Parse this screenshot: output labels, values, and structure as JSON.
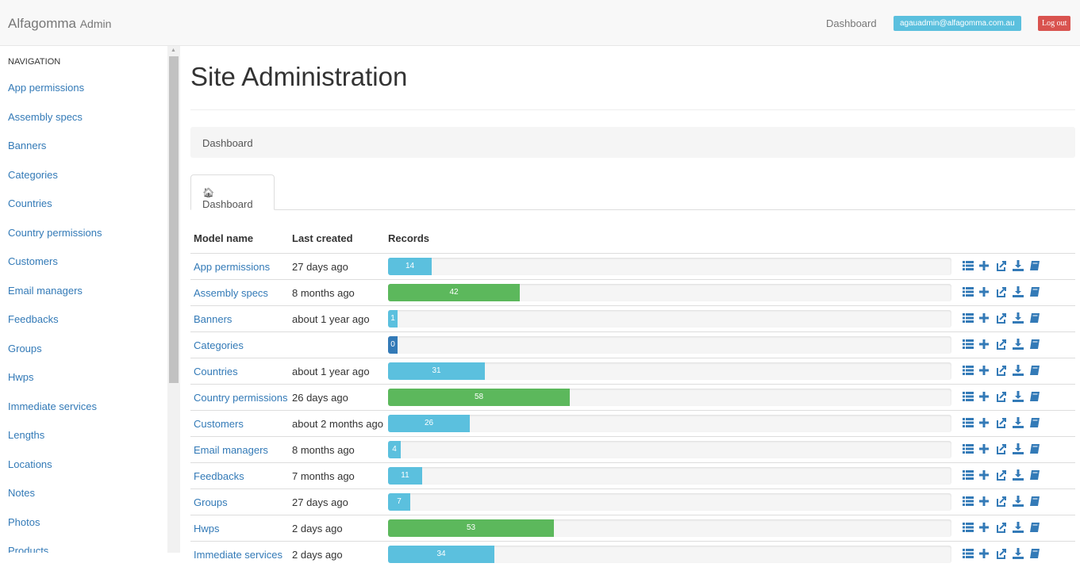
{
  "header": {
    "brand": "Alfagomma",
    "brand_sub": "Admin",
    "nav_dashboard": "Dashboard",
    "user_email": "agauadmin@alfagomma.com.au",
    "logout": "Log out"
  },
  "sidebar": {
    "heading": "NAVIGATION",
    "items": [
      {
        "label": "App permissions"
      },
      {
        "label": "Assembly specs"
      },
      {
        "label": "Banners"
      },
      {
        "label": "Categories"
      },
      {
        "label": "Countries"
      },
      {
        "label": "Country permissions"
      },
      {
        "label": "Customers"
      },
      {
        "label": "Email managers"
      },
      {
        "label": "Feedbacks"
      },
      {
        "label": "Groups"
      },
      {
        "label": "Hwps"
      },
      {
        "label": "Immediate services"
      },
      {
        "label": "Lengths"
      },
      {
        "label": "Locations"
      },
      {
        "label": "Notes"
      },
      {
        "label": "Photos"
      },
      {
        "label": "Products"
      }
    ]
  },
  "main": {
    "title": "Site Administration",
    "breadcrumb": "Dashboard",
    "tab_label": "Dashboard",
    "table": {
      "headers": [
        "Model name",
        "Last created",
        "Records"
      ],
      "max_records": 180,
      "rows": [
        {
          "name": "App permissions",
          "last": "27 days ago",
          "records": 14,
          "color": "info"
        },
        {
          "name": "Assembly specs",
          "last": "8 months ago",
          "records": 42,
          "color": "success"
        },
        {
          "name": "Banners",
          "last": "about 1 year ago",
          "records": 1,
          "color": "info"
        },
        {
          "name": "Categories",
          "last": "",
          "records": 0,
          "color": "primary"
        },
        {
          "name": "Countries",
          "last": "about 1 year ago",
          "records": 31,
          "color": "info"
        },
        {
          "name": "Country permissions",
          "last": "26 days ago",
          "records": 58,
          "color": "success"
        },
        {
          "name": "Customers",
          "last": "about 2 months ago",
          "records": 26,
          "color": "info"
        },
        {
          "name": "Email managers",
          "last": "8 months ago",
          "records": 4,
          "color": "info"
        },
        {
          "name": "Feedbacks",
          "last": "7 months ago",
          "records": 11,
          "color": "info"
        },
        {
          "name": "Groups",
          "last": "27 days ago",
          "records": 7,
          "color": "info"
        },
        {
          "name": "Hwps",
          "last": "2 days ago",
          "records": 53,
          "color": "success"
        },
        {
          "name": "Immediate services",
          "last": "2 days ago",
          "records": 34,
          "color": "info"
        }
      ],
      "action_icons": [
        "list-icon",
        "plus-icon",
        "export-icon",
        "download-icon",
        "book-icon"
      ]
    }
  },
  "colors": {
    "link": "#337ab7",
    "info": "#5bc0de",
    "success": "#5cb85c",
    "primary": "#337ab7",
    "danger": "#d9534f"
  }
}
